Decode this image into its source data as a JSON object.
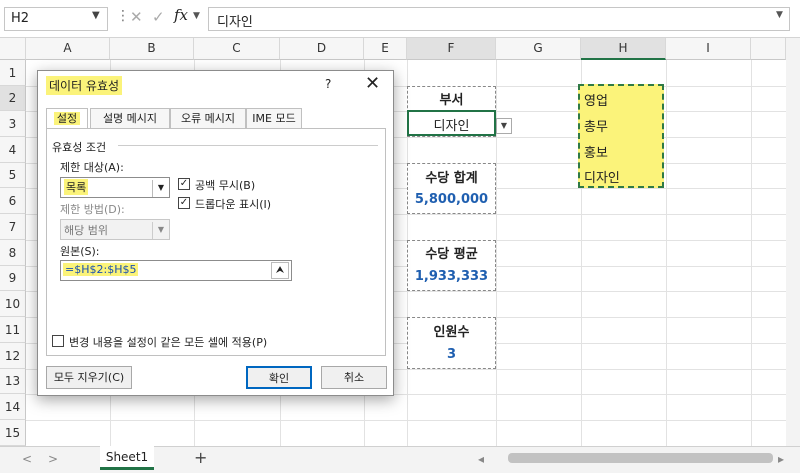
{
  "formula_bar": {
    "name_box": "H2",
    "fx": "fx",
    "content": "디자인"
  },
  "columns": [
    "A",
    "B",
    "C",
    "D",
    "E",
    "F",
    "G",
    "H",
    "I"
  ],
  "rows": [
    "1",
    "2",
    "3",
    "4",
    "5",
    "6",
    "7",
    "8",
    "9",
    "10",
    "11",
    "12",
    "13",
    "14",
    "15"
  ],
  "cells": {
    "f2": "부서",
    "f3": "디자인",
    "f5": "수당 합계",
    "f6": "5,800,000",
    "f8": "수당 평균",
    "f9": "1,933,333",
    "f11": "인원수",
    "f12": "3"
  },
  "list_items": [
    "영업",
    "총무",
    "홍보",
    "디자인"
  ],
  "sheet_tab": "Sheet1",
  "dialog": {
    "title": "데이터 유효성",
    "help": "?",
    "tabs": [
      "설정",
      "설명 메시지",
      "오류 메시지",
      "IME 모드"
    ],
    "section": "유효성 조건",
    "allow_label": "제한 대상(A):",
    "allow_value": "목록",
    "data_label": "제한 방법(D):",
    "data_value": "해당 범위",
    "ignore_blank": "공백 무시(B)",
    "in_cell_dropdown": "드롭다운 표시(I)",
    "source_label": "원본(S):",
    "source_value": "=$H$2:$H$5",
    "apply_all": "변경 내용을 설정이 같은 모든 셀에 적용(P)",
    "clear_all": "모두 지우기(C)",
    "ok": "확인",
    "cancel": "취소"
  },
  "colors": {
    "accent": "#217346",
    "highlight": "#fbf37a",
    "value_blue": "#1f5fb0"
  }
}
